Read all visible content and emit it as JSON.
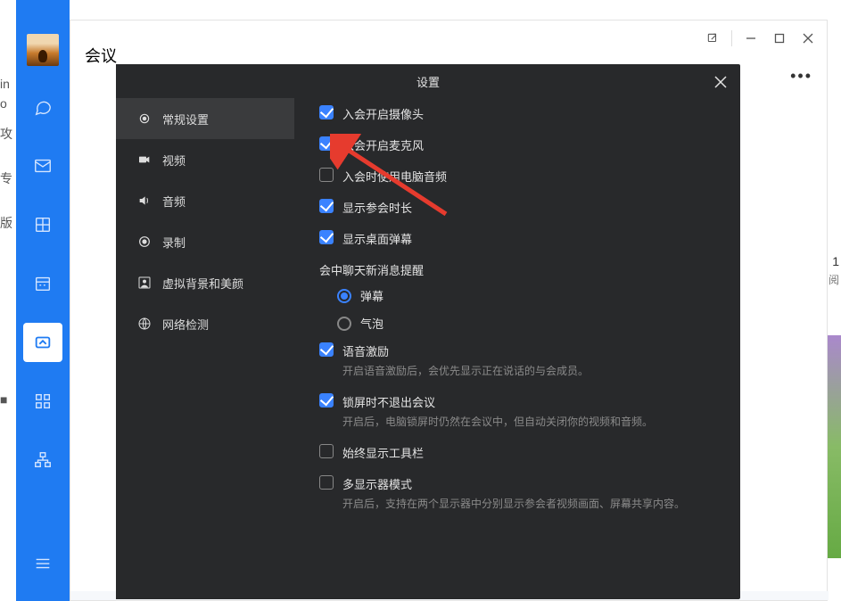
{
  "header": {
    "title": "会议"
  },
  "modal": {
    "title": "设置",
    "sidebar": [
      {
        "label": "常规设置",
        "icon": "gear",
        "active": true
      },
      {
        "label": "视频",
        "icon": "camera"
      },
      {
        "label": "音频",
        "icon": "speaker"
      },
      {
        "label": "录制",
        "icon": "record"
      },
      {
        "label": "虚拟背景和美颜",
        "icon": "user-frame"
      },
      {
        "label": "网络检测",
        "icon": "globe"
      }
    ],
    "options": {
      "open_camera": {
        "label": "入会开启摄像头",
        "checked": true
      },
      "open_mic": {
        "label": "入会开启麦克风",
        "checked": true
      },
      "use_pc_audio": {
        "label": "入会时使用电脑音频",
        "checked": false
      },
      "show_duration": {
        "label": "显示参会时长",
        "checked": true
      },
      "show_danmu": {
        "label": "显示桌面弹幕",
        "checked": true
      },
      "chat_notify_title": "会中聊天新消息提醒",
      "chat_notify": {
        "danmu": "弹幕",
        "bubble": "气泡",
        "selected": "danmu"
      },
      "voice_boost": {
        "label": "语音激励",
        "desc": "开启语音激励后，会优先显示正在说话的与会成员。",
        "checked": true
      },
      "lock_no_exit": {
        "label": "锁屏时不退出会议",
        "desc": "开启后，电脑锁屏时仍然在会议中，但自动关闭你的视频和音频。",
        "checked": true
      },
      "always_toolbar": {
        "label": "始终显示工具栏",
        "checked": false
      },
      "multi_monitor": {
        "label": "多显示器模式",
        "desc": "开启后，支持在两个显示器中分别显示参会者视频画面、屏幕共享内容。",
        "checked": false
      }
    }
  }
}
